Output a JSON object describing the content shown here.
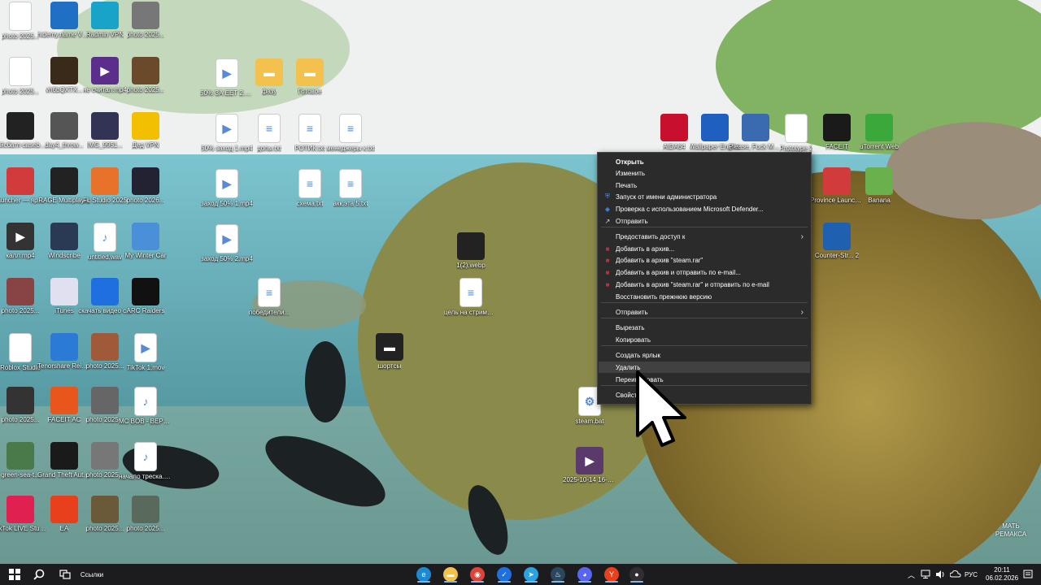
{
  "desktop_icons": [
    {
      "label": "photo 2025...",
      "icon": "image-icon",
      "color": "#ffffff"
    },
    {
      "label": "hidemy.name VPN 2.0",
      "icon": "vpn-icon",
      "color": "#1f6fc5"
    },
    {
      "label": "Radmin VPN",
      "icon": "radmin-icon",
      "color": "#1aa3c9"
    },
    {
      "label": "photo 2025...",
      "icon": "image-icon",
      "color": "#777777"
    },
    {
      "label": "photo 2025...",
      "icon": "image-icon",
      "color": "#ffffff"
    },
    {
      "label": "vh6bQXTX...",
      "icon": "image-icon",
      "color": "#3a2a1a"
    },
    {
      "label": "не считал.mp4",
      "icon": "video-icon",
      "color": "#5b2e8c"
    },
    {
      "label": "photo 2025...",
      "icon": "image-icon",
      "color": "#6a4a2a"
    },
    {
      "label": "кейсбатл casebattle...",
      "icon": "image-icon",
      "color": "#222222"
    },
    {
      "label": "day4_throw...",
      "icon": "image-icon",
      "color": "#555555"
    },
    {
      "label": "IMG_9951...",
      "icon": "image-icon",
      "color": "#333355"
    },
    {
      "label": "Дед VPN",
      "icon": "ded-vpn-icon",
      "color": "#f2c000"
    },
    {
      "label": "Launcher — ярлык",
      "icon": "launcher-icon",
      "color": "#d23b3b"
    },
    {
      "label": "RAGE Multiplayer",
      "icon": "rage-icon",
      "color": "#222222"
    },
    {
      "label": "FL Studio 2025",
      "icon": "fl-studio-icon",
      "color": "#e8722a"
    },
    {
      "label": "photo 2026...",
      "icon": "image-icon",
      "color": "#222233"
    },
    {
      "label": "калл.mp4",
      "icon": "video-icon",
      "color": "#333333"
    },
    {
      "label": "Windscribe",
      "icon": "windscribe-icon",
      "color": "#2a3a55"
    },
    {
      "label": "untitled.wav",
      "icon": "audio-icon",
      "color": "#ffffff"
    },
    {
      "label": "My Winter Car",
      "icon": "mwc-icon",
      "color": "#4a90d9"
    },
    {
      "label": "photo 2025...",
      "icon": "image-icon",
      "color": "#884444"
    },
    {
      "label": "iTunes",
      "icon": "itunes-icon",
      "color": "#e0e0f0"
    },
    {
      "label": "скачать видео с...",
      "icon": "download-icon",
      "color": "#1e6fe0"
    },
    {
      "label": "ARC Raiders",
      "icon": "arc-raiders-icon",
      "color": "#111111"
    },
    {
      "label": "Roblox Studio",
      "icon": "document-icon",
      "color": "#ffffff"
    },
    {
      "label": "Tenorshare ReiBoot",
      "icon": "reiboot-icon",
      "color": "#2a7ad6"
    },
    {
      "label": "photo 2025...",
      "icon": "image-icon",
      "color": "#a05a3a"
    },
    {
      "label": "TikTok 1.mov",
      "icon": "video-file-icon",
      "color": "#ffffff"
    },
    {
      "label": "photo 2025...",
      "icon": "image-icon",
      "color": "#333333"
    },
    {
      "label": "FACEIT AC",
      "icon": "faceit-ac-icon",
      "color": "#e8561c"
    },
    {
      "label": "photo 2025...",
      "icon": "image-icon",
      "color": "#666666"
    },
    {
      "label": "MC BOB - ВЕРНУЛС...",
      "icon": "audio-icon",
      "color": "#ffffff"
    },
    {
      "label": "green-sea-t...",
      "icon": "image-icon",
      "color": "#4a7a4a"
    },
    {
      "label": "Grand Theft Auto V En...",
      "icon": "gta-icon",
      "color": "#1a1a1a"
    },
    {
      "label": "photo 2025...",
      "icon": "image-icon",
      "color": "#777777"
    },
    {
      "label": "начало треска.mp3",
      "icon": "audio-icon",
      "color": "#ffffff"
    },
    {
      "label": "TikTok LIVE Studio",
      "icon": "tiktok-icon",
      "color": "#e02050"
    },
    {
      "label": "EA",
      "icon": "ea-icon",
      "color": "#e8401c"
    },
    {
      "label": "photo 2025...",
      "icon": "image-icon",
      "color": "#6a5a3a"
    },
    {
      "label": "photo 2025...",
      "icon": "image-icon",
      "color": "#5a6a5a"
    },
    {
      "label": "50% ЗА ЕЕТ 2.mp4",
      "icon": "video-file-icon",
      "color": "#ffffff"
    },
    {
      "label": "фазу",
      "icon": "folder-icon",
      "color": "#f2c14e"
    },
    {
      "label": "Готовое",
      "icon": "folder-icon",
      "color": "#f2c14e"
    },
    {
      "label": "50% заход 1.mp4",
      "icon": "video-file-icon",
      "color": "#ffffff"
    },
    {
      "label": "допы.txt",
      "icon": "text-file-icon",
      "color": "#ffffff"
    },
    {
      "label": "РОТИК.txt",
      "icon": "text-file-icon",
      "color": "#ffffff"
    },
    {
      "label": "менеджеры к.txt",
      "icon": "text-file-icon",
      "color": "#ffffff"
    },
    {
      "label": "заход 50% 1.mp4",
      "icon": "video-file-icon",
      "color": "#ffffff"
    },
    {
      "label": "схема.txt",
      "icon": "text-file-icon",
      "color": "#ffffff"
    },
    {
      "label": "акк.эта 5.txt",
      "icon": "text-file-icon",
      "color": "#ffffff"
    },
    {
      "label": "заход 50% 2.mp4",
      "icon": "video-file-icon",
      "color": "#ffffff"
    },
    {
      "label": "победители...",
      "icon": "text-file-icon",
      "color": "#ffffff"
    },
    {
      "label": "цель на стримы та...",
      "icon": "text-file-icon",
      "color": "#ffffff"
    },
    {
      "label": "1(2).webp",
      "icon": "image-icon",
      "color": "#222222"
    },
    {
      "label": "шортсы",
      "icon": "folder-icon",
      "color": "#222222"
    },
    {
      "label": "steam.bat",
      "icon": "bat-file-icon",
      "color": "#ffffff"
    },
    {
      "label": "2025-10-14 16-17-50.mkv",
      "icon": "video-icon",
      "color": "#5a3a6a"
    },
    {
      "label": "AIDA64",
      "icon": "aida64-icon",
      "color": "#c8102e"
    },
    {
      "label": "Wallpaper Engine",
      "icon": "wallpaper-engine-icon",
      "color": "#1e5fbf"
    },
    {
      "label": "Please, Fuck Me Tri...",
      "icon": "game-icon",
      "color": "#3a6ab0"
    },
    {
      "label": "Prototype 2",
      "icon": "document-icon",
      "color": "#ffffff"
    },
    {
      "label": "FACEIT",
      "icon": "faceit-icon",
      "color": "#1a1a1a"
    },
    {
      "label": "uTorrent Web",
      "icon": "utorrent-icon",
      "color": "#3aa83a"
    },
    {
      "label": "Province Launcher",
      "icon": "province-icon",
      "color": "#d23b3b"
    },
    {
      "label": "Banana",
      "icon": "banana-icon",
      "color": "#6ab04c"
    },
    {
      "label": "Counter-Str... 2",
      "icon": "cs2-icon",
      "color": "#2060b0"
    }
  ],
  "context_menu": {
    "items": [
      {
        "label": "Открыть",
        "bold": true,
        "icon": ""
      },
      {
        "label": "Изменить",
        "icon": ""
      },
      {
        "label": "Печать",
        "icon": ""
      },
      {
        "label": "Запуск от имени администратора",
        "icon": "shield-icon"
      },
      {
        "label": "Проверка с использованием Microsoft Defender...",
        "icon": "defender-icon"
      },
      {
        "label": "Отправить",
        "icon": "share-icon"
      },
      {
        "label": "Предоставить доступ к",
        "icon": "",
        "arrow": true
      },
      {
        "label": "Добавить в архив...",
        "icon": "winrar-icon"
      },
      {
        "label": "Добавить в архив \"steam.rar\"",
        "icon": "winrar-icon"
      },
      {
        "label": "Добавить в архив и отправить по e-mail...",
        "icon": "winrar-icon"
      },
      {
        "label": "Добавить в архив \"steam.rar\" и отправить по e-mail",
        "icon": "winrar-icon"
      },
      {
        "label": "Восстановить прежнюю версию",
        "icon": ""
      },
      {
        "label": "Отправить",
        "icon": "",
        "arrow": true
      },
      {
        "label": "Вырезать",
        "icon": ""
      },
      {
        "label": "Копировать",
        "icon": ""
      },
      {
        "label": "Создать ярлык",
        "icon": ""
      },
      {
        "label": "Удалить",
        "icon": "",
        "hover": true
      },
      {
        "label": "Переименовать",
        "icon": ""
      },
      {
        "label": "Свойства",
        "icon": ""
      }
    ]
  },
  "watermark": "МАТЬ РЕМАКСА",
  "taskbar": {
    "search_label": "Ссылки",
    "apps": [
      {
        "name": "edge-icon",
        "color": "#1b8ad3"
      },
      {
        "name": "file-explorer-icon",
        "color": "#f2c14e"
      },
      {
        "name": "chrome-icon",
        "color": "#db4437"
      },
      {
        "name": "checkmark-app-icon",
        "color": "#1e6fe0"
      },
      {
        "name": "telegram-icon",
        "color": "#2aa3e0"
      },
      {
        "name": "steam-icon",
        "color": "#2a475e"
      },
      {
        "name": "discord-icon",
        "color": "#5865f2"
      },
      {
        "name": "yandex-browser-icon",
        "color": "#e8401c"
      },
      {
        "name": "obs-icon",
        "color": "#302e31"
      }
    ],
    "language": "РУС",
    "time": "20:11",
    "date": "06.02.2026"
  }
}
